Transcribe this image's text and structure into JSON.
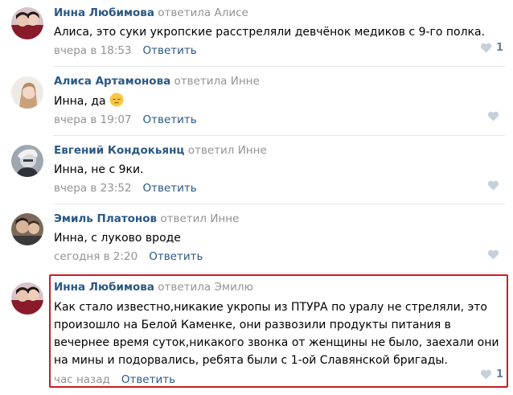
{
  "comments": [
    {
      "author": "Инна Любимова",
      "reply_verb": "ответила",
      "reply_to": "Алисе",
      "text": "Алиса, это суки укропские расстреляли девчёнок медиков с 9-го полка.",
      "date": "вчера в 18:53",
      "reply_label": "Ответить",
      "likes": "1"
    },
    {
      "author": "Алиса Артамонова",
      "reply_verb": "ответила",
      "reply_to": "Инне",
      "text": "Инна, да",
      "emoji": "pensive-face-emoji",
      "date": "вчера в 19:07",
      "reply_label": "Ответить",
      "likes": ""
    },
    {
      "author": "Евгений Кондокьянц",
      "reply_verb": "ответил",
      "reply_to": "Инне",
      "text": "Инна, не с 9ки.",
      "date": "вчера в 23:52",
      "reply_label": "Ответить",
      "likes": ""
    },
    {
      "author": "Эмиль Платонов",
      "reply_verb": "ответил",
      "reply_to": "Инне",
      "text": "Инна, с луково вроде",
      "date": "сегодня в 2:20",
      "reply_label": "Ответить",
      "likes": ""
    },
    {
      "author": "Инна Любимова",
      "reply_verb": "ответила",
      "reply_to": "Эмилю",
      "text_lines": [
        "Как стало известно,никакие укропы из ПТУРА по уралу не стреляли, это",
        "произошло на Белой Каменке, они развозили продукты питания в",
        "вечернее время суток,никакого звонка от женщины не было, заехали они",
        "на мины и подорвались, ребята были с 1-ой Славянской бригады."
      ],
      "date": "час назад",
      "reply_label": "Ответить",
      "likes": "1"
    }
  ],
  "colors": {
    "author": "#2a5885",
    "muted": "#939393",
    "link": "#2a5885",
    "highlight_border": "#cc1b24",
    "divider": "#e3e6ea",
    "like_icon": "#c5d0db"
  }
}
